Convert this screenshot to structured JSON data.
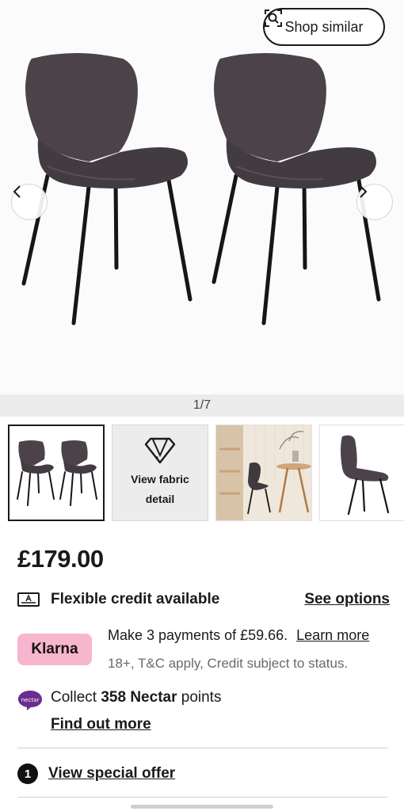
{
  "gallery": {
    "shop_similar_label": "Shop similar",
    "shop_similar_icon": "visual-search-icon",
    "prev_icon": "chevron-left-icon",
    "next_icon": "chevron-right-icon",
    "counter": "1/7",
    "product_image": "two-grey-velvet-dining-chairs",
    "thumbnails": [
      {
        "image": "pair-of-chairs",
        "selected": true
      },
      {
        "label": "View fabric detail",
        "icon": "fabric-swatch-icon"
      },
      {
        "image": "chair-in-dining-room"
      },
      {
        "image": "chair-side-view"
      }
    ]
  },
  "product": {
    "price": "£179.00",
    "credit": {
      "icon": "credit-card-icon",
      "label": "Flexible credit available",
      "link": "See options"
    },
    "klarna": {
      "brand": "Klarna",
      "offer": "Make 3 payments of £59.66.",
      "learn_more": "Learn more",
      "terms": "18+, T&C apply, Credit subject to status."
    },
    "nectar": {
      "icon_text": "nectar",
      "prefix": "Collect ",
      "points": "358 Nectar",
      "suffix": " points",
      "link": "Find out more"
    },
    "special_offer": {
      "count": "1",
      "label": "View special offer"
    }
  },
  "colors": {
    "klarna_pink": "#f6b6cd",
    "nectar_purple": "#6b2c91",
    "chair_fabric": "#4b4349",
    "text": "#1a1a1a"
  }
}
